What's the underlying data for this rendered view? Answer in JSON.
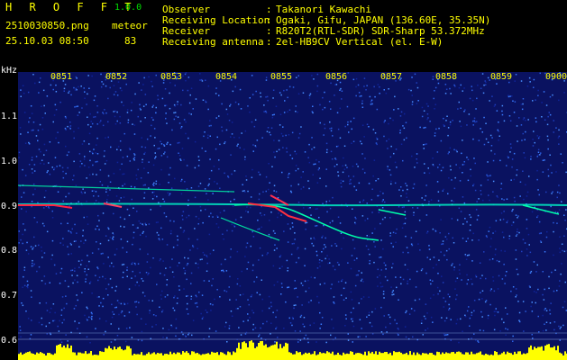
{
  "app": {
    "title": "H R O F F T",
    "version": "1.0.0"
  },
  "file": {
    "name": "2510030850.png",
    "datetime": "25.10.03 08:50",
    "type_label": "meteor",
    "count": "83"
  },
  "info": [
    {
      "label": "Observer",
      "sep": ":",
      "value": "Takanori Kawachi"
    },
    {
      "label": "Receiving Location",
      "sep": ":",
      "value": "Ogaki, Gifu, JAPAN (136.60E, 35.35N)"
    },
    {
      "label": "Receiver",
      "sep": ":",
      "value": "R820T2(RTL-SDR) SDR-Sharp 53.372MHz"
    },
    {
      "label": "Receiving antenna",
      "sep": ":",
      "value": "2el-HB9CV Vertical (el. E-W)"
    }
  ],
  "axis": {
    "y_unit": "kHz",
    "y_ticks": [
      "1.1",
      "1.0",
      "0.9",
      "0.8",
      "0.7",
      "0.6"
    ],
    "x_ticks": [
      "0851",
      "0852",
      "0853",
      "0854",
      "0855",
      "0856",
      "0857",
      "0858",
      "0859",
      "0900"
    ]
  },
  "colors": {
    "background": "#0a1260",
    "text": "#ffff00",
    "ylabels": "#ffffff",
    "signal": "#00ffaa",
    "bars": "#ffff00"
  }
}
